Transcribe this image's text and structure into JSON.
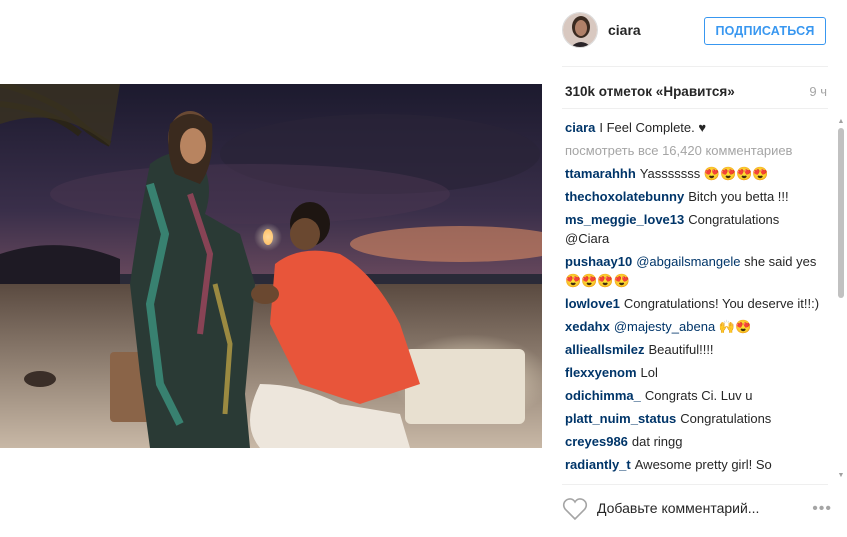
{
  "header": {
    "username": "ciara",
    "follow_label": "ПОДПИСАТЬСЯ"
  },
  "stats": {
    "likes": "310k отметок «Нравится»",
    "time": "9 ч"
  },
  "caption": {
    "author": "ciara",
    "text": "I Feel Complete. ♥"
  },
  "view_all": "посмотреть все 16,420 комментариев",
  "comments": [
    {
      "author": "ttamarahhh",
      "mention": "",
      "text": "Yasssssss 😍😍😍😍"
    },
    {
      "author": "thechoxolatebunny",
      "mention": "",
      "text": "Bitch you betta !!!"
    },
    {
      "author": "ms_meggie_love13",
      "mention": "",
      "text": "Congratulations @Ciara"
    },
    {
      "author": "pushaay10",
      "mention": "@abgailsmangele",
      "text": "she said yes😍😍😍😍"
    },
    {
      "author": "lowlove1",
      "mention": "",
      "text": "Congratulations! You deserve it!!:)"
    },
    {
      "author": "xedahx",
      "mention": "@majesty_abena",
      "text": "🙌😍"
    },
    {
      "author": "allieallsmilez",
      "mention": "",
      "text": "Beautiful!!!!"
    },
    {
      "author": "flexxyenom",
      "mention": "",
      "text": "Lol"
    },
    {
      "author": "odichimma_",
      "mention": "",
      "text": "Congrats Ci. Luv u"
    },
    {
      "author": "platt_nuim_status",
      "mention": "",
      "text": "Congratulations"
    },
    {
      "author": "creyes986",
      "mention": "",
      "text": "dat ringg"
    },
    {
      "author": "radiantly_t",
      "mention": "",
      "text": "Awesome pretty girl! So"
    }
  ],
  "footer": {
    "comment_placeholder": "Добавьте комментарий...",
    "more_label": "•••"
  },
  "colors": {
    "link": "#003569",
    "button": "#3897f0",
    "muted": "#a5a5a5"
  }
}
